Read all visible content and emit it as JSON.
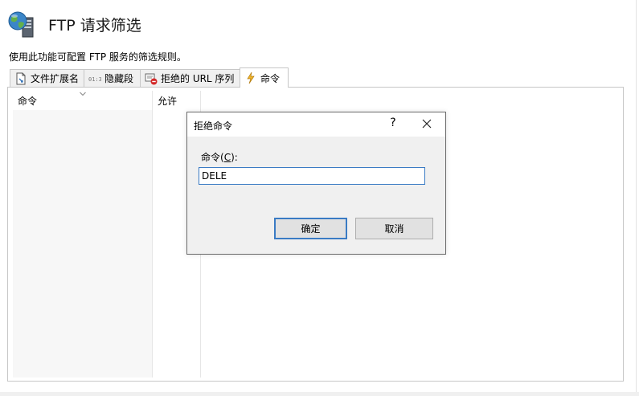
{
  "header": {
    "icon": "globe-server-icon",
    "title": "FTP 请求筛选",
    "description": "使用此功能可配置 FTP 服务的筛选规则。"
  },
  "tabs": [
    {
      "label": "文件扩展名",
      "icon": "document-icon",
      "active": false
    },
    {
      "label": "隐藏段",
      "icon": "hidden-segment-icon",
      "active": false
    },
    {
      "label": "拒绝的 URL 序列",
      "icon": "deny-url-icon",
      "active": false
    },
    {
      "label": "命令",
      "icon": "lightning-icon",
      "active": true
    }
  ],
  "table": {
    "columns": [
      {
        "label": "命令",
        "sorted": true
      },
      {
        "label": "允许",
        "sorted": false
      }
    ],
    "rows": []
  },
  "dialog": {
    "title": "拒绝命令",
    "help_label": "?",
    "field_label_prefix": "命令(",
    "field_label_hotkey": "C",
    "field_label_suffix": "):",
    "field_value": "DELE",
    "ok_label": "确定",
    "cancel_label": "取消"
  },
  "colors": {
    "accent_border": "#3a7bc4",
    "dialog_bg": "#f0f0f0",
    "button_bg": "#e1e1e1",
    "panel_border": "#c7c7c7"
  }
}
